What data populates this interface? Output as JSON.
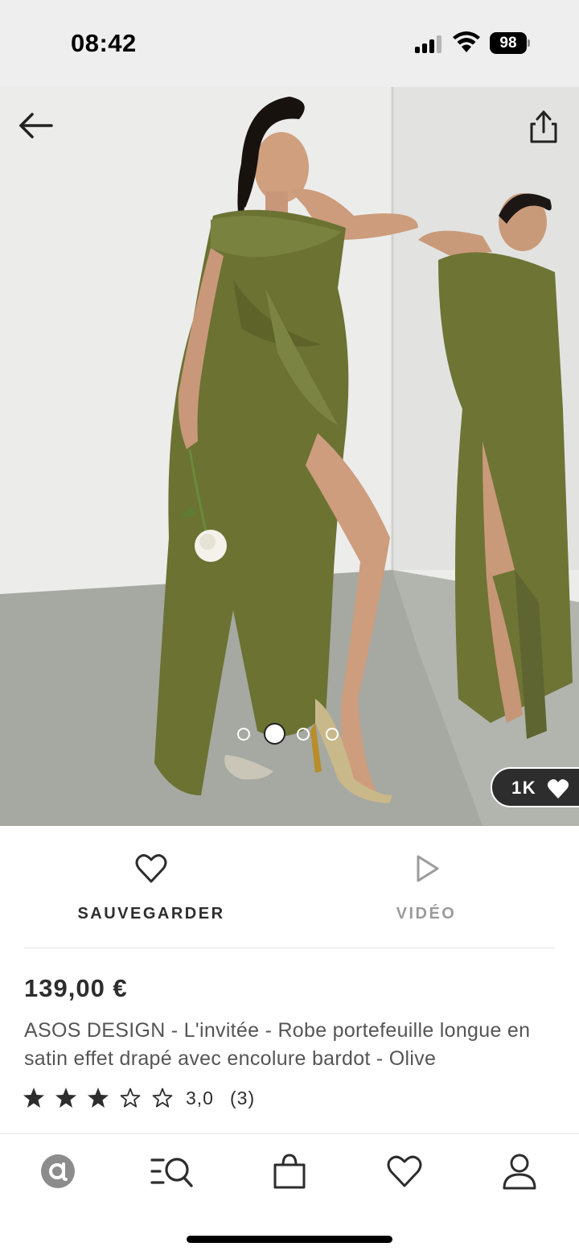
{
  "status_bar": {
    "time": "08:42",
    "battery": "98"
  },
  "hero": {
    "image_count": 4,
    "active_image": 1,
    "likes": "1K",
    "icons": [
      "back-arrow-icon",
      "share-icon",
      "heart-icon"
    ]
  },
  "actions": {
    "save_label": "SAUVEGARDER",
    "video_label": "VIDÉO"
  },
  "product": {
    "price": "139,00 €",
    "title": "ASOS DESIGN - L'invitée - Robe portefeuille longue en satin effet drapé avec encolure bardot - Olive",
    "rating_value": "3,0",
    "rating_count": "(3)",
    "stars_filled": 3,
    "stars_total": 5
  },
  "bottom_nav": {
    "items": [
      "home-icon",
      "search-icon",
      "bag-icon",
      "saved-icon",
      "account-icon"
    ]
  },
  "colors": {
    "text_dark": "#2d2d2d",
    "text_muted": "#9b9b9b",
    "dress_olive": "#6b7232",
    "pill_bg": "#2d2d2d"
  }
}
